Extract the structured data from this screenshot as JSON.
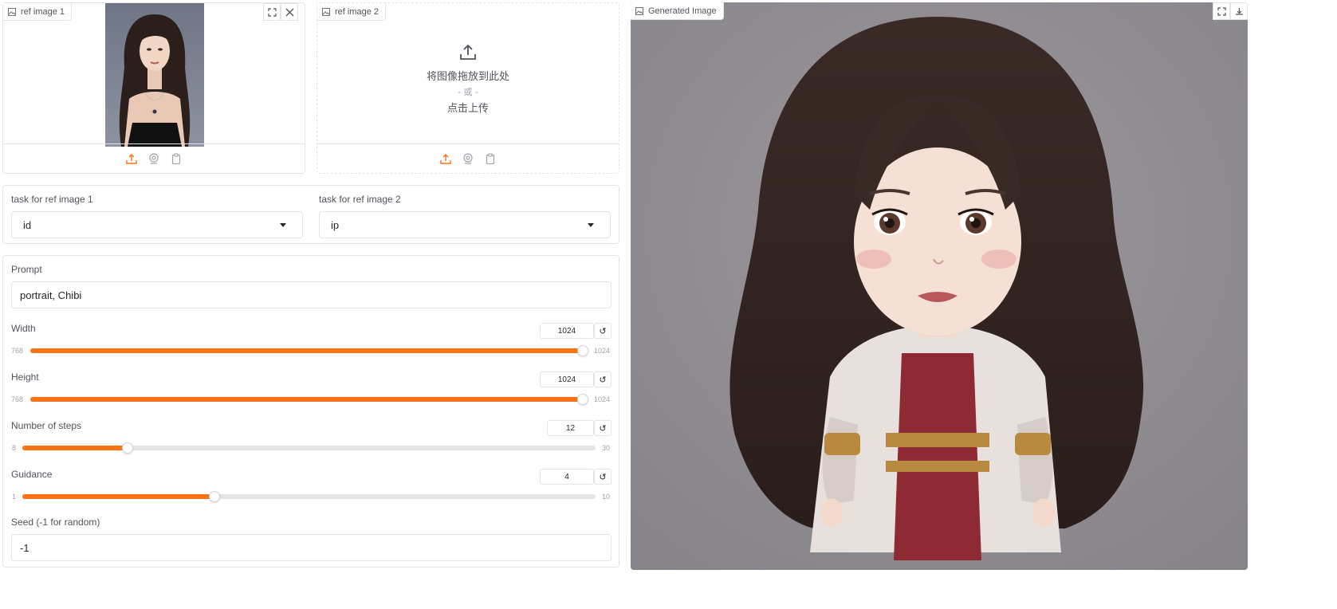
{
  "ref1": {
    "label": "ref image 1"
  },
  "ref2": {
    "label": "ref image 2",
    "drop_text": "将图像拖放到此处",
    "or_text": "- 或 -",
    "click_text": "点击上传"
  },
  "tasks": {
    "ref1_label": "task for ref image 1",
    "ref1_value": "id",
    "ref2_label": "task for ref image 2",
    "ref2_value": "ip"
  },
  "prompt": {
    "label": "Prompt",
    "value": "portrait, Chibi"
  },
  "width": {
    "label": "Width",
    "value": "1024",
    "min": "768",
    "max": "1024",
    "fraction": 1.0
  },
  "height": {
    "label": "Height",
    "value": "1024",
    "min": "768",
    "max": "1024",
    "fraction": 1.0
  },
  "steps": {
    "label": "Number of steps",
    "value": "12",
    "min": "8",
    "max": "30",
    "fraction": 0.1818
  },
  "guidance": {
    "label": "Guidance",
    "value": "4",
    "min": "1",
    "max": "10",
    "fraction": 0.3333
  },
  "seed": {
    "label": "Seed (-1 for random)",
    "value": "-1"
  },
  "output": {
    "label": "Generated Image"
  },
  "icons": {
    "reset": "↺",
    "upload": "upload-icon",
    "webcam": "webcam-icon",
    "clipboard": "clipboard-icon",
    "fullscreen": "fullscreen-icon",
    "close": "close-icon",
    "download": "download-icon"
  },
  "colors": {
    "accent": "#f97316",
    "border": "#e4e4e7",
    "output_bg": "#8f8c92"
  }
}
